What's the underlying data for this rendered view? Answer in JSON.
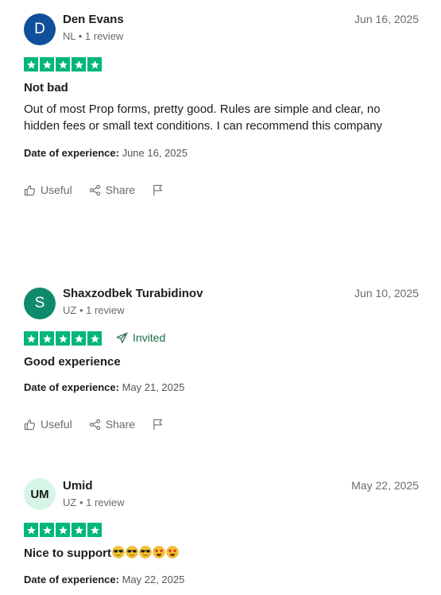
{
  "reviews": [
    {
      "avatar": {
        "initial": "D",
        "bg": "#0f4f9c",
        "fg": "#ffffff"
      },
      "name": "Den Evans",
      "meta": "NL • 1 review",
      "date": "Jun 16, 2025",
      "rating": 5,
      "invited": null,
      "title": "Not bad",
      "body": "Out of most Prop forms, pretty good. Rules are simple and clear, no hidden fees or small text conditions. I can recommend this company",
      "exp_label": "Date of experience:",
      "exp_date": "June 16, 2025",
      "actions": {
        "useful": "Useful",
        "share": "Share"
      }
    },
    {
      "avatar": {
        "initial": "S",
        "bg": "#0f8a6c",
        "fg": "#ffffff"
      },
      "name": "Shaxzodbek Turabidinov",
      "meta": "UZ • 1 review",
      "date": "Jun 10, 2025",
      "rating": 5,
      "invited": "Invited",
      "title": "Good experience",
      "body": "",
      "exp_label": "Date of experience:",
      "exp_date": "May 21, 2025",
      "actions": {
        "useful": "Useful",
        "share": "Share"
      }
    },
    {
      "avatar": {
        "initial": "UM",
        "bg": "#d6f5e6",
        "fg": "#1c1c1c"
      },
      "name": "Umid",
      "meta": "UZ • 1 review",
      "date": "May 22, 2025",
      "rating": 5,
      "invited": null,
      "title": "Nice to support",
      "title_emojis": [
        "sunglasses-emoji",
        "sunglasses-emoji",
        "sunglasses-emoji",
        "star-struck-emoji",
        "star-struck-emoji"
      ],
      "body": "",
      "exp_label": "Date of experience:",
      "exp_date": "May 22, 2025"
    }
  ],
  "colors": {
    "star_green": "#00b67a",
    "invited_green": "#1d6b45",
    "muted": "#6b6b6b"
  }
}
